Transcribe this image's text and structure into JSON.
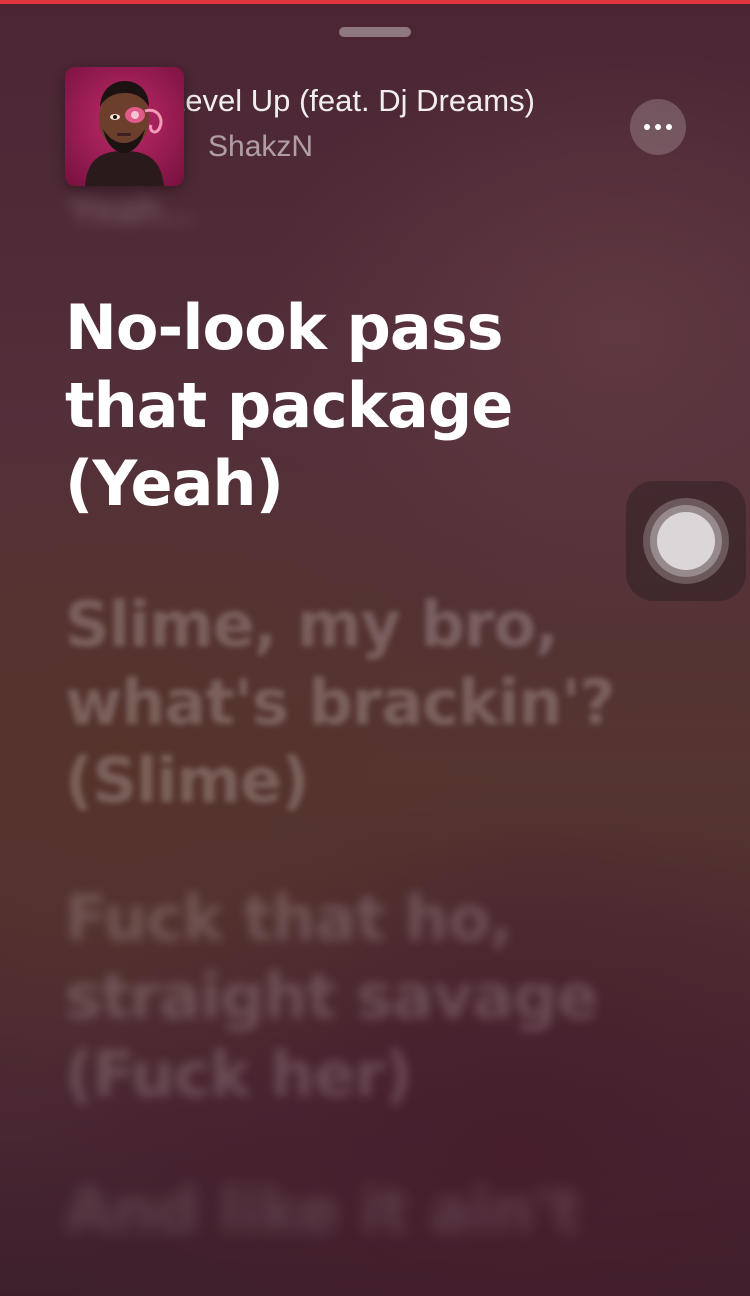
{
  "now_playing": {
    "title": "Level Up (feat. Dj Dreams)",
    "artist": "ShakzN",
    "artwork_icon": "album-artwork-portrait"
  },
  "lyrics": {
    "previous_line": "Yeah...",
    "active_line": "No-look pass that package (Yeah)",
    "upcoming": [
      "Slime, my bro, what's brackin'? (Slime)",
      "Fuck that ho, straight savage (Fuck her)",
      "And like it ain't"
    ]
  },
  "icons": {
    "more": "ellipsis-icon",
    "assistive_touch": "assistive-touch-icon"
  },
  "colors": {
    "top_accent": "#e0343c",
    "lyric_active": "#ffffff"
  }
}
